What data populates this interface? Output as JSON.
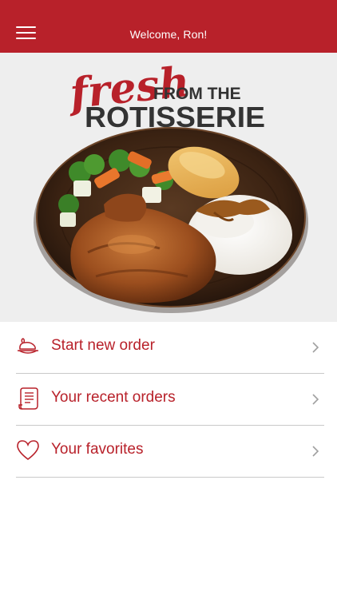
{
  "header": {
    "welcome_text": "Welcome, Ron!",
    "background_color": "#b8212a",
    "menu_icon": "hamburger-menu-icon"
  },
  "hero": {
    "headline_script": "fresh",
    "headline_small": "FROM THE",
    "headline_large": "ROTISSERIE",
    "script_color": "#b8212a",
    "text_color": "#333333",
    "image_subject": "rotisserie chicken plate"
  },
  "menu": {
    "items": [
      {
        "label": "Start new order",
        "icon": "rotisserie-chicken-icon"
      },
      {
        "label": "Your recent orders",
        "icon": "receipt-scroll-icon"
      },
      {
        "label": "Your favorites",
        "icon": "heart-icon"
      }
    ],
    "accent_color": "#b8212a",
    "chevron_icon": "chevron-right-icon"
  }
}
